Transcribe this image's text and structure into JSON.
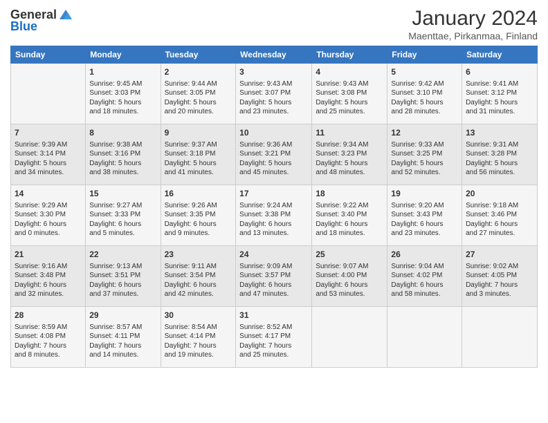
{
  "header": {
    "logo_general": "General",
    "logo_blue": "Blue",
    "title": "January 2024",
    "subtitle": "Maenttae, Pirkanmaa, Finland"
  },
  "weekdays": [
    "Sunday",
    "Monday",
    "Tuesday",
    "Wednesday",
    "Thursday",
    "Friday",
    "Saturday"
  ],
  "weeks": [
    [
      {
        "day": "",
        "info": ""
      },
      {
        "day": "1",
        "info": "Sunrise: 9:45 AM\nSunset: 3:03 PM\nDaylight: 5 hours\nand 18 minutes."
      },
      {
        "day": "2",
        "info": "Sunrise: 9:44 AM\nSunset: 3:05 PM\nDaylight: 5 hours\nand 20 minutes."
      },
      {
        "day": "3",
        "info": "Sunrise: 9:43 AM\nSunset: 3:07 PM\nDaylight: 5 hours\nand 23 minutes."
      },
      {
        "day": "4",
        "info": "Sunrise: 9:43 AM\nSunset: 3:08 PM\nDaylight: 5 hours\nand 25 minutes."
      },
      {
        "day": "5",
        "info": "Sunrise: 9:42 AM\nSunset: 3:10 PM\nDaylight: 5 hours\nand 28 minutes."
      },
      {
        "day": "6",
        "info": "Sunrise: 9:41 AM\nSunset: 3:12 PM\nDaylight: 5 hours\nand 31 minutes."
      }
    ],
    [
      {
        "day": "7",
        "info": "Sunrise: 9:39 AM\nSunset: 3:14 PM\nDaylight: 5 hours\nand 34 minutes."
      },
      {
        "day": "8",
        "info": "Sunrise: 9:38 AM\nSunset: 3:16 PM\nDaylight: 5 hours\nand 38 minutes."
      },
      {
        "day": "9",
        "info": "Sunrise: 9:37 AM\nSunset: 3:18 PM\nDaylight: 5 hours\nand 41 minutes."
      },
      {
        "day": "10",
        "info": "Sunrise: 9:36 AM\nSunset: 3:21 PM\nDaylight: 5 hours\nand 45 minutes."
      },
      {
        "day": "11",
        "info": "Sunrise: 9:34 AM\nSunset: 3:23 PM\nDaylight: 5 hours\nand 48 minutes."
      },
      {
        "day": "12",
        "info": "Sunrise: 9:33 AM\nSunset: 3:25 PM\nDaylight: 5 hours\nand 52 minutes."
      },
      {
        "day": "13",
        "info": "Sunrise: 9:31 AM\nSunset: 3:28 PM\nDaylight: 5 hours\nand 56 minutes."
      }
    ],
    [
      {
        "day": "14",
        "info": "Sunrise: 9:29 AM\nSunset: 3:30 PM\nDaylight: 6 hours\nand 0 minutes."
      },
      {
        "day": "15",
        "info": "Sunrise: 9:27 AM\nSunset: 3:33 PM\nDaylight: 6 hours\nand 5 minutes."
      },
      {
        "day": "16",
        "info": "Sunrise: 9:26 AM\nSunset: 3:35 PM\nDaylight: 6 hours\nand 9 minutes."
      },
      {
        "day": "17",
        "info": "Sunrise: 9:24 AM\nSunset: 3:38 PM\nDaylight: 6 hours\nand 13 minutes."
      },
      {
        "day": "18",
        "info": "Sunrise: 9:22 AM\nSunset: 3:40 PM\nDaylight: 6 hours\nand 18 minutes."
      },
      {
        "day": "19",
        "info": "Sunrise: 9:20 AM\nSunset: 3:43 PM\nDaylight: 6 hours\nand 23 minutes."
      },
      {
        "day": "20",
        "info": "Sunrise: 9:18 AM\nSunset: 3:46 PM\nDaylight: 6 hours\nand 27 minutes."
      }
    ],
    [
      {
        "day": "21",
        "info": "Sunrise: 9:16 AM\nSunset: 3:48 PM\nDaylight: 6 hours\nand 32 minutes."
      },
      {
        "day": "22",
        "info": "Sunrise: 9:13 AM\nSunset: 3:51 PM\nDaylight: 6 hours\nand 37 minutes."
      },
      {
        "day": "23",
        "info": "Sunrise: 9:11 AM\nSunset: 3:54 PM\nDaylight: 6 hours\nand 42 minutes."
      },
      {
        "day": "24",
        "info": "Sunrise: 9:09 AM\nSunset: 3:57 PM\nDaylight: 6 hours\nand 47 minutes."
      },
      {
        "day": "25",
        "info": "Sunrise: 9:07 AM\nSunset: 4:00 PM\nDaylight: 6 hours\nand 53 minutes."
      },
      {
        "day": "26",
        "info": "Sunrise: 9:04 AM\nSunset: 4:02 PM\nDaylight: 6 hours\nand 58 minutes."
      },
      {
        "day": "27",
        "info": "Sunrise: 9:02 AM\nSunset: 4:05 PM\nDaylight: 7 hours\nand 3 minutes."
      }
    ],
    [
      {
        "day": "28",
        "info": "Sunrise: 8:59 AM\nSunset: 4:08 PM\nDaylight: 7 hours\nand 8 minutes."
      },
      {
        "day": "29",
        "info": "Sunrise: 8:57 AM\nSunset: 4:11 PM\nDaylight: 7 hours\nand 14 minutes."
      },
      {
        "day": "30",
        "info": "Sunrise: 8:54 AM\nSunset: 4:14 PM\nDaylight: 7 hours\nand 19 minutes."
      },
      {
        "day": "31",
        "info": "Sunrise: 8:52 AM\nSunset: 4:17 PM\nDaylight: 7 hours\nand 25 minutes."
      },
      {
        "day": "",
        "info": ""
      },
      {
        "day": "",
        "info": ""
      },
      {
        "day": "",
        "info": ""
      }
    ]
  ]
}
